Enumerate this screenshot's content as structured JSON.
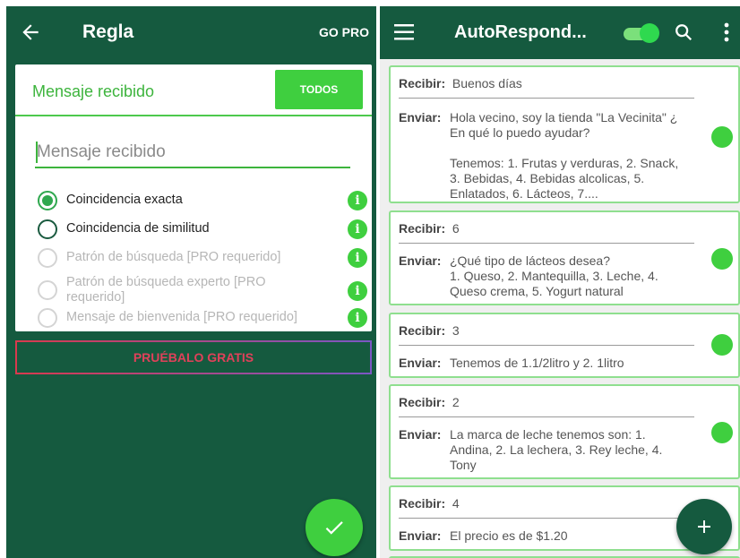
{
  "left": {
    "title": "Regla",
    "go_pro": "GO PRO",
    "card": {
      "title": "Mensaje recibido",
      "todos_label": "TODOS",
      "input_placeholder": "Mensaje recibido",
      "options": [
        {
          "label": "Coincidencia exacta",
          "selected": true,
          "enabled": true
        },
        {
          "label": "Coincidencia de similitud",
          "selected": false,
          "enabled": true
        },
        {
          "label": "Patrón de búsqueda [PRO requerido]",
          "selected": false,
          "enabled": false
        },
        {
          "label": "Patrón de búsqueda experto [PRO requerido]",
          "selected": false,
          "enabled": false
        },
        {
          "label": "Mensaje de bienvenida [PRO requerido]",
          "selected": false,
          "enabled": false
        }
      ],
      "info_glyph": "i"
    },
    "try_button": "PRUÉBALO GRATIS",
    "fab_icon": "check-icon"
  },
  "right": {
    "title": "AutoRespond...",
    "toggle_on": true,
    "recv_key": "Recibir:",
    "send_key": "Enviar:",
    "rules": [
      {
        "recibir": "Buenos días",
        "enviar": "Hola vecino, soy la tienda \"La Vecinita\" ¿ En qué lo puedo ayudar?\n\nTenemos: 1. Frutas y verduras, 2. Snack, 3. Bebidas, 4. Bebidas alcolicas, 5. Enlatados, 6. Lácteos, 7...."
      },
      {
        "recibir": "6",
        "enviar": "¿Qué tipo de lácteos desea?\n1. Queso, 2. Mantequilla, 3. Leche, 4. Queso crema, 5. Yogurt natural"
      },
      {
        "recibir": "3",
        "enviar": "Tenemos de 1.1/2litro y 2. 1litro"
      },
      {
        "recibir": "2",
        "enviar": "La marca de leche tenemos son: 1. Andina, 2. La lechera, 3. Rey leche, 4. Tony"
      },
      {
        "recibir": "4",
        "enviar": "El precio es de $1.20"
      }
    ],
    "fab_icon": "plus-icon"
  },
  "colors": {
    "toolbar": "#155a3f",
    "accent": "#3fcf3f",
    "try_text": "#e0415a"
  }
}
